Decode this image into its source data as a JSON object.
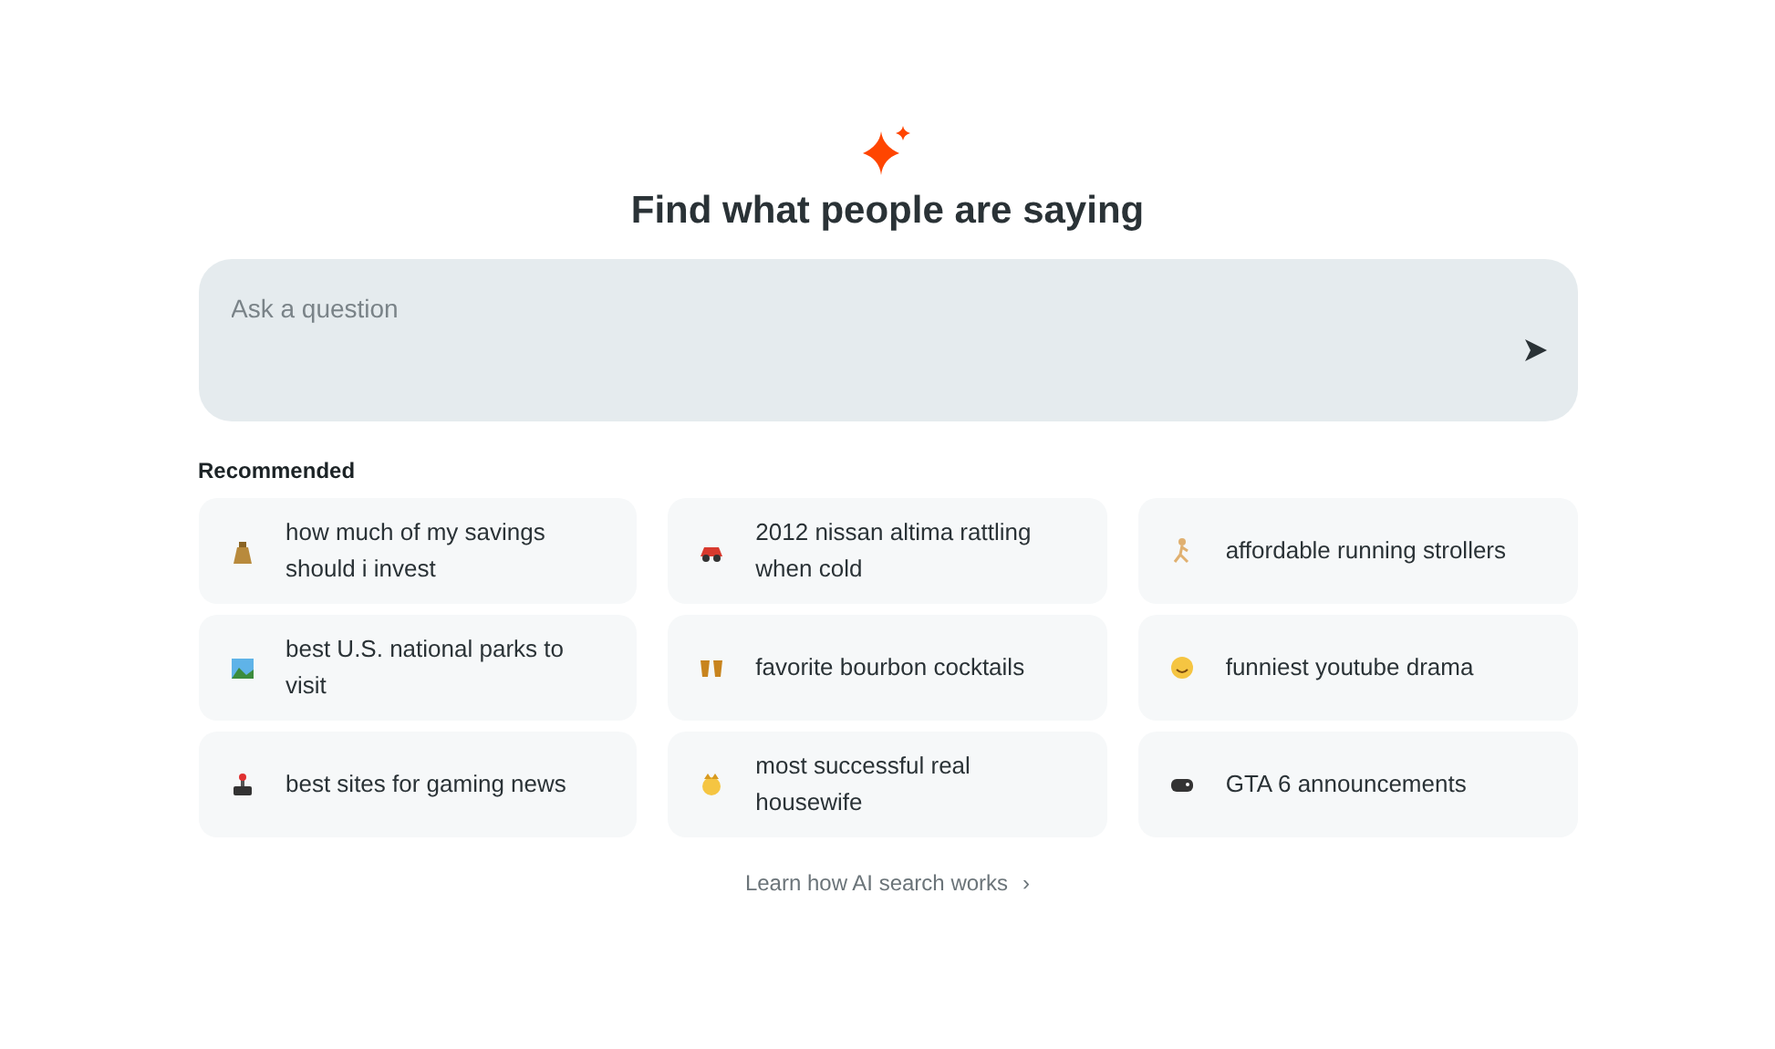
{
  "heading": "Find what people are saying",
  "search": {
    "placeholder": "Ask a question"
  },
  "recommended": {
    "title": "Recommended",
    "items": [
      {
        "text": "how much of my savings should i invest"
      },
      {
        "text": "2012 nissan altima rattling when cold"
      },
      {
        "text": "affordable running strollers"
      },
      {
        "text": "best U.S. national parks to visit"
      },
      {
        "text": "favorite bourbon cocktails"
      },
      {
        "text": "funniest youtube drama"
      },
      {
        "text": "best sites for gaming news"
      },
      {
        "text": "most successful real housewife"
      },
      {
        "text": "GTA 6 announcements"
      }
    ]
  },
  "footer_link": {
    "text": "Learn how AI search works",
    "arrow": "›"
  }
}
